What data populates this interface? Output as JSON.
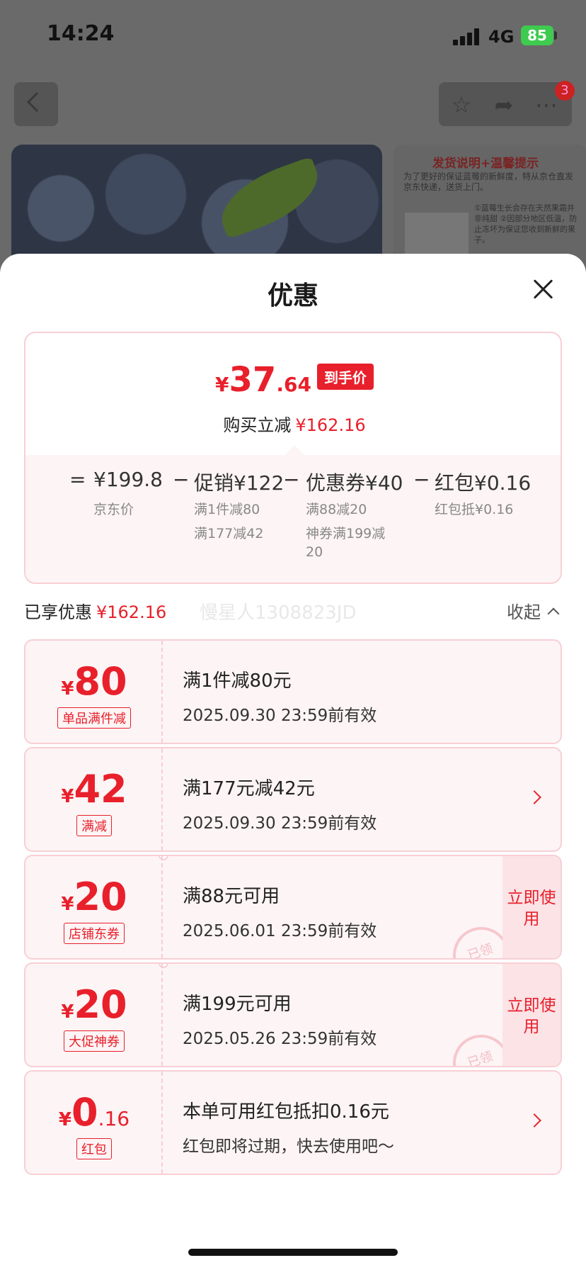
{
  "status_bar": {
    "time": "14:24",
    "network": "4G",
    "battery": "85"
  },
  "nav": {
    "badge_count": "3"
  },
  "notice": {
    "title": "发货说明+温馨提示",
    "text": "为了更好的保证蓝莓的新鲜度，特从京仓直发京东快递，送货上门。",
    "side": "①蓝莓生长会存在天然果霜并非纯甜 ②因部分地区低温，防止冻坏为保证您收到新鲜的果子。"
  },
  "sheet": {
    "title": "优惠"
  },
  "summary": {
    "price_symbol": "¥",
    "price_int": "37",
    "price_dec": ".64",
    "price_tag": "到手价",
    "save_label": "购买立减",
    "save_amount": "¥162.16",
    "formula": {
      "equals": "=",
      "jd_price": "¥199.8",
      "jd_price_label": "京东价",
      "minus1": "−",
      "promo": "促销¥122",
      "promo_sub1": "满1件减80",
      "promo_sub2": "满177减42",
      "minus2": "−",
      "coupon": "优惠券¥40",
      "coupon_sub1": "满88减20",
      "coupon_sub2a": "神券满199减",
      "coupon_sub2b": "20",
      "minus3": "−",
      "redpacket": "红包¥0.16",
      "redpacket_sub": "红包抵¥0.16"
    }
  },
  "enjoyed": {
    "label": "已享优惠",
    "amount": "¥162.16",
    "watermark": "慢星人1308823JD",
    "collapse": "收起"
  },
  "coupons": [
    {
      "symbol": "¥",
      "amount": "80",
      "decimal": "",
      "tag": "单品满件减",
      "line1": "满1件减80元",
      "line2": "2025.09.30 23:59前有效"
    },
    {
      "symbol": "¥",
      "amount": "42",
      "decimal": "",
      "tag": "满减",
      "line1": "满177元减42元",
      "line2": "2025.09.30 23:59前有效"
    },
    {
      "symbol": "¥",
      "amount": "20",
      "decimal": "",
      "tag": "店铺东券",
      "line1": "满88元可用",
      "line2": "2025.06.01 23:59前有效",
      "action": "立即使用",
      "stamp": "已领"
    },
    {
      "symbol": "¥",
      "amount": "20",
      "decimal": "",
      "tag": "大促神券",
      "line1": "满199元可用",
      "line2": "2025.05.26 23:59前有效",
      "action": "立即使用",
      "stamp": "已领"
    },
    {
      "symbol": "¥",
      "amount": "0",
      "decimal": ".16",
      "tag": "红包",
      "line1": "本单可用红包抵扣0.16元",
      "line2": "红包即将过期，快去使用吧～"
    }
  ],
  "colors": {
    "accent": "#e8202b",
    "border": "#f8cfd5",
    "card_bg": "#fdf4f5"
  }
}
